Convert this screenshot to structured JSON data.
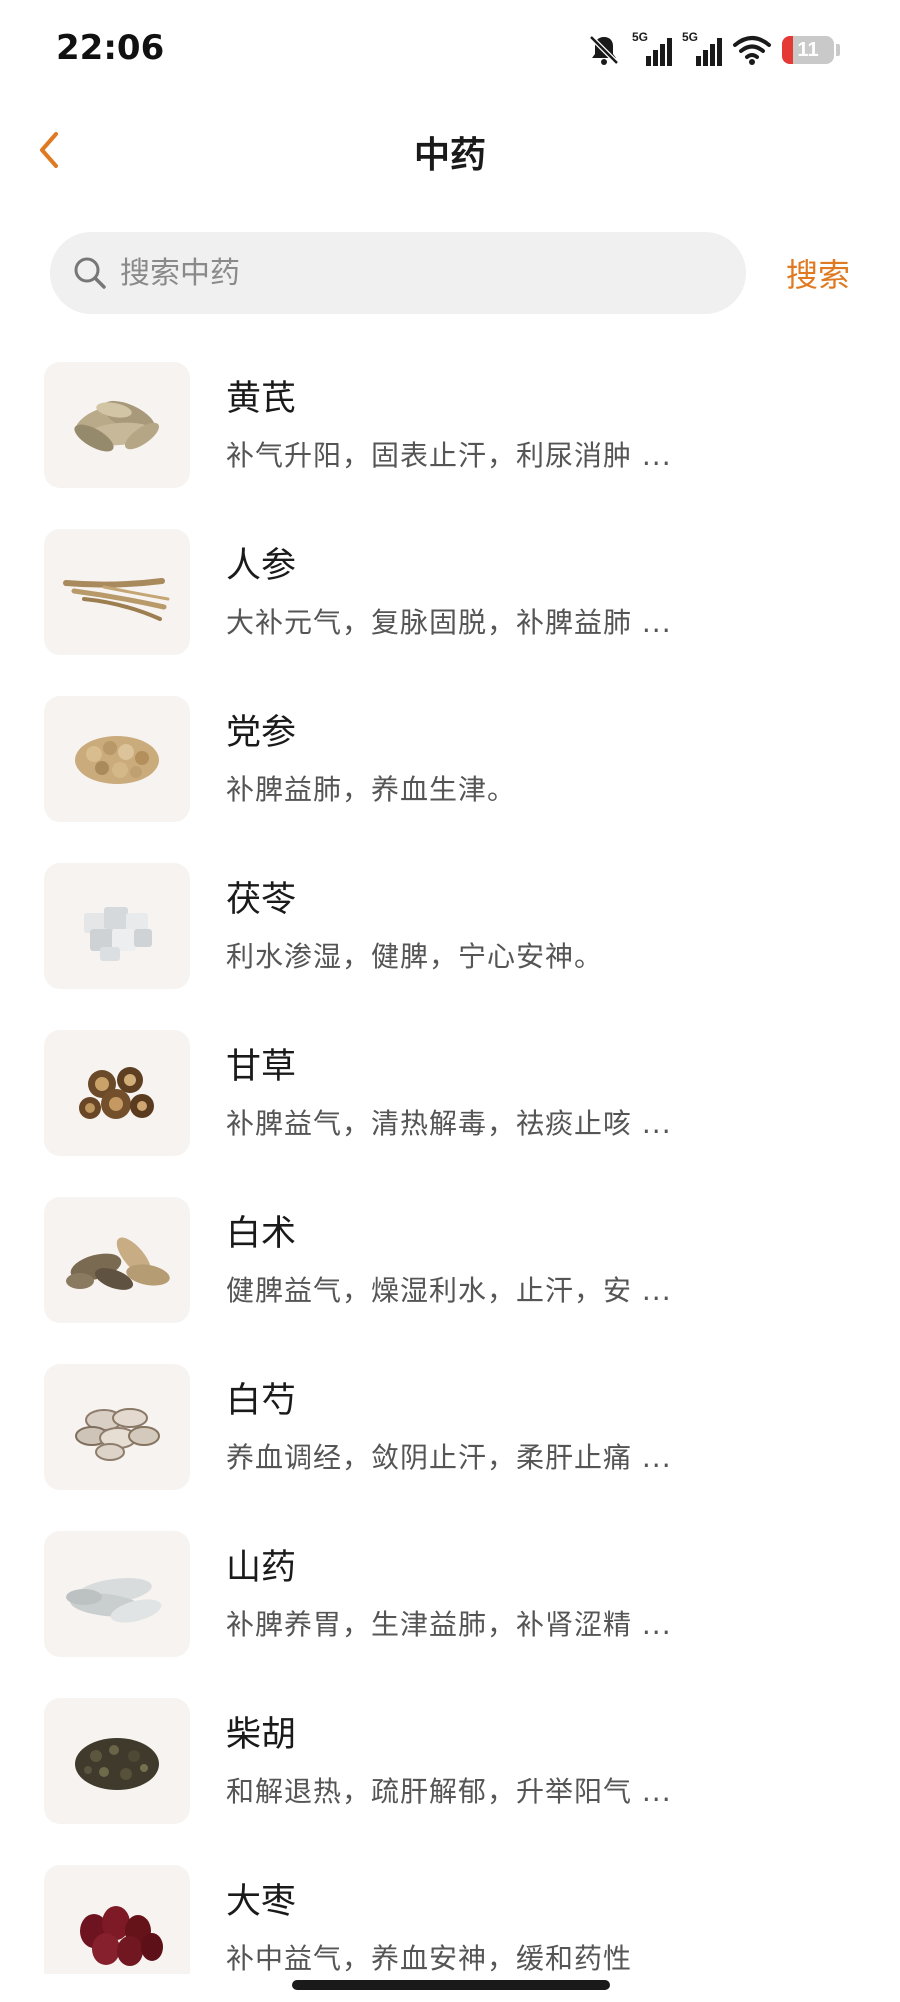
{
  "status_bar": {
    "time": "22:06",
    "signal_1_label": "5G",
    "signal_2_label": "5G",
    "battery_level": "11",
    "icons": [
      "mute-bell-icon",
      "signal-5g-icon",
      "signal-5g-icon",
      "wifi-icon",
      "battery-icon"
    ]
  },
  "header": {
    "title": "中药",
    "back_icon": "chevron-left-icon"
  },
  "search": {
    "placeholder": "搜索中药",
    "value": "",
    "button_label": "搜索",
    "icon": "search-icon"
  },
  "colors": {
    "accent": "#e07a22",
    "battery_low": "#e53935"
  },
  "herbs": [
    {
      "name": "黄芪",
      "desc": "补气升阳，固表止汗，利尿消肿 ..."
    },
    {
      "name": "人参",
      "desc": "大补元气，复脉固脱，补脾益肺 ..."
    },
    {
      "name": "党参",
      "desc": "补脾益肺，养血生津。"
    },
    {
      "name": "茯苓",
      "desc": "利水渗湿，健脾，宁心安神。"
    },
    {
      "name": "甘草",
      "desc": "补脾益气，清热解毒，祛痰止咳 ..."
    },
    {
      "name": "白术",
      "desc": "健脾益气，燥湿利水，止汗，安 ..."
    },
    {
      "name": "白芍",
      "desc": "养血调经，敛阴止汗，柔肝止痛 ..."
    },
    {
      "name": "山药",
      "desc": "补脾养胃，生津益肺，补肾涩精 ..."
    },
    {
      "name": "柴胡",
      "desc": "和解退热，疏肝解郁，升举阳气 ..."
    },
    {
      "name": "大枣",
      "desc": "补中益气，养血安神，缓和药性"
    }
  ]
}
